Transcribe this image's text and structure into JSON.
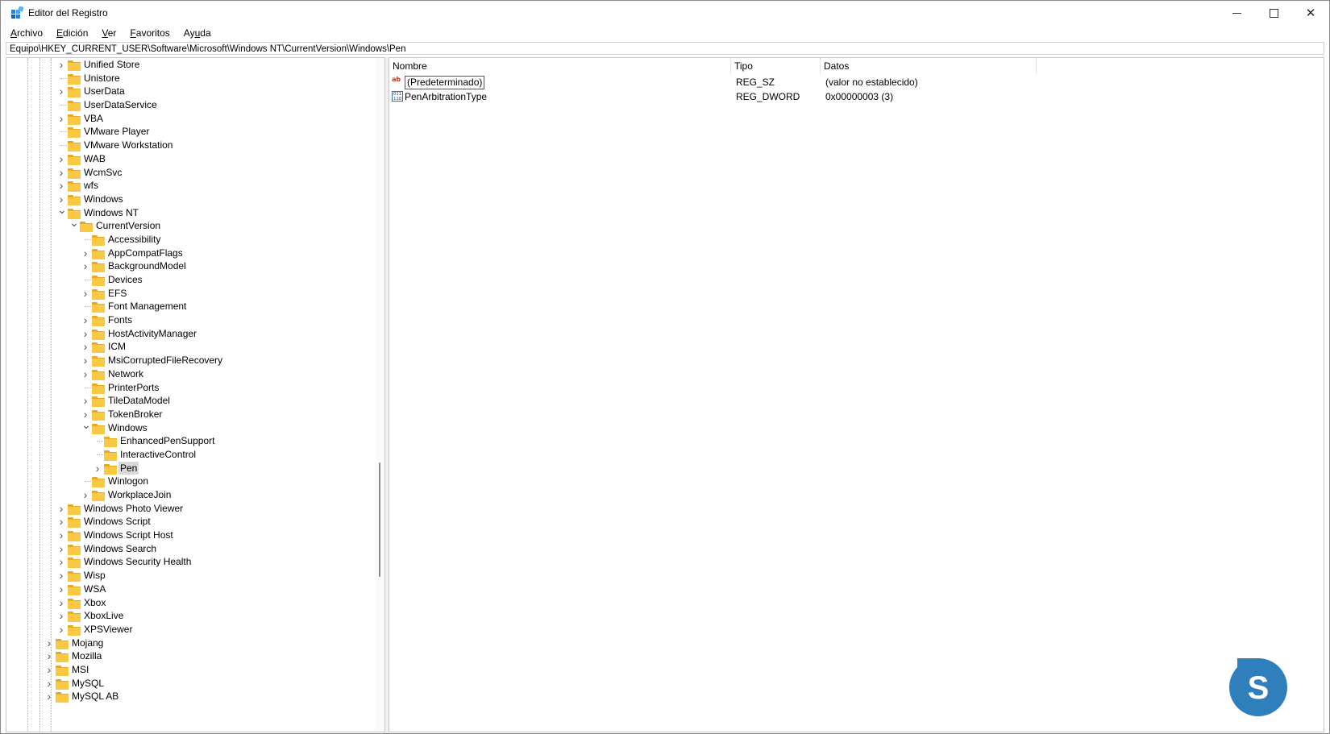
{
  "window": {
    "title": "Editor del Registro"
  },
  "menu": [
    "Archivo",
    "Edición",
    "Ver",
    "Favoritos",
    "Ayuda"
  ],
  "address": "Equipo\\HKEY_CURRENT_USER\\Software\\Microsoft\\Windows NT\\CurrentVersion\\Windows\\Pen",
  "tree": [
    {
      "label": "Unified Store",
      "level": 2,
      "expander": "collapsed"
    },
    {
      "label": "Unistore",
      "level": 2,
      "expander": "none"
    },
    {
      "label": "UserData",
      "level": 2,
      "expander": "collapsed"
    },
    {
      "label": "UserDataService",
      "level": 2,
      "expander": "none"
    },
    {
      "label": "VBA",
      "level": 2,
      "expander": "collapsed"
    },
    {
      "label": "VMware Player",
      "level": 2,
      "expander": "none"
    },
    {
      "label": "VMware Workstation",
      "level": 2,
      "expander": "none"
    },
    {
      "label": "WAB",
      "level": 2,
      "expander": "collapsed"
    },
    {
      "label": "WcmSvc",
      "level": 2,
      "expander": "collapsed"
    },
    {
      "label": "wfs",
      "level": 2,
      "expander": "collapsed"
    },
    {
      "label": "Windows",
      "level": 2,
      "expander": "collapsed"
    },
    {
      "label": "Windows NT",
      "level": 2,
      "expander": "expanded"
    },
    {
      "label": "CurrentVersion",
      "level": 3,
      "expander": "expanded"
    },
    {
      "label": "Accessibility",
      "level": 4,
      "expander": "none"
    },
    {
      "label": "AppCompatFlags",
      "level": 4,
      "expander": "collapsed"
    },
    {
      "label": "BackgroundModel",
      "level": 4,
      "expander": "collapsed"
    },
    {
      "label": "Devices",
      "level": 4,
      "expander": "none"
    },
    {
      "label": "EFS",
      "level": 4,
      "expander": "collapsed"
    },
    {
      "label": "Font Management",
      "level": 4,
      "expander": "none"
    },
    {
      "label": "Fonts",
      "level": 4,
      "expander": "collapsed"
    },
    {
      "label": "HostActivityManager",
      "level": 4,
      "expander": "collapsed"
    },
    {
      "label": "ICM",
      "level": 4,
      "expander": "collapsed"
    },
    {
      "label": "MsiCorruptedFileRecovery",
      "level": 4,
      "expander": "collapsed"
    },
    {
      "label": "Network",
      "level": 4,
      "expander": "collapsed"
    },
    {
      "label": "PrinterPorts",
      "level": 4,
      "expander": "none"
    },
    {
      "label": "TileDataModel",
      "level": 4,
      "expander": "collapsed"
    },
    {
      "label": "TokenBroker",
      "level": 4,
      "expander": "collapsed"
    },
    {
      "label": "Windows",
      "level": 4,
      "expander": "expanded"
    },
    {
      "label": "EnhancedPenSupport",
      "level": 5,
      "expander": "none"
    },
    {
      "label": "InteractiveControl",
      "level": 5,
      "expander": "none"
    },
    {
      "label": "Pen",
      "level": 5,
      "expander": "collapsed",
      "selected": true
    },
    {
      "label": "Winlogon",
      "level": 4,
      "expander": "none"
    },
    {
      "label": "WorkplaceJoin",
      "level": 4,
      "expander": "collapsed"
    },
    {
      "label": "Windows Photo Viewer",
      "level": 2,
      "expander": "collapsed"
    },
    {
      "label": "Windows Script",
      "level": 2,
      "expander": "collapsed"
    },
    {
      "label": "Windows Script Host",
      "level": 2,
      "expander": "collapsed"
    },
    {
      "label": "Windows Search",
      "level": 2,
      "expander": "collapsed"
    },
    {
      "label": "Windows Security Health",
      "level": 2,
      "expander": "collapsed"
    },
    {
      "label": "Wisp",
      "level": 2,
      "expander": "collapsed"
    },
    {
      "label": "WSA",
      "level": 2,
      "expander": "collapsed"
    },
    {
      "label": "Xbox",
      "level": 2,
      "expander": "collapsed"
    },
    {
      "label": "XboxLive",
      "level": 2,
      "expander": "collapsed"
    },
    {
      "label": "XPSViewer",
      "level": 2,
      "expander": "collapsed"
    },
    {
      "label": "Mojang",
      "level": 1,
      "expander": "collapsed"
    },
    {
      "label": "Mozilla",
      "level": 1,
      "expander": "collapsed"
    },
    {
      "label": "MSI",
      "level": 1,
      "expander": "collapsed"
    },
    {
      "label": "MySQL",
      "level": 1,
      "expander": "collapsed"
    },
    {
      "label": "MySQL AB",
      "level": 1,
      "expander": "collapsed"
    }
  ],
  "columns": [
    "Nombre",
    "Tipo",
    "Datos"
  ],
  "values": [
    {
      "icon": "string-value-icon",
      "glyph": "ab",
      "name": "(Predeterminado)",
      "type": "REG_SZ",
      "data": "(valor no establecido)"
    },
    {
      "icon": "dword-value-icon",
      "glyph": "011\n110",
      "name": "PenArbitrationType",
      "type": "REG_DWORD",
      "data": "0x00000003 (3)"
    }
  ],
  "logo": {
    "icon": "solvetic-logo-icon",
    "letter": "S"
  },
  "colors": {
    "folder": "#f9c943",
    "selection": "#d9d9d9",
    "logo": "#2f7fbd"
  }
}
